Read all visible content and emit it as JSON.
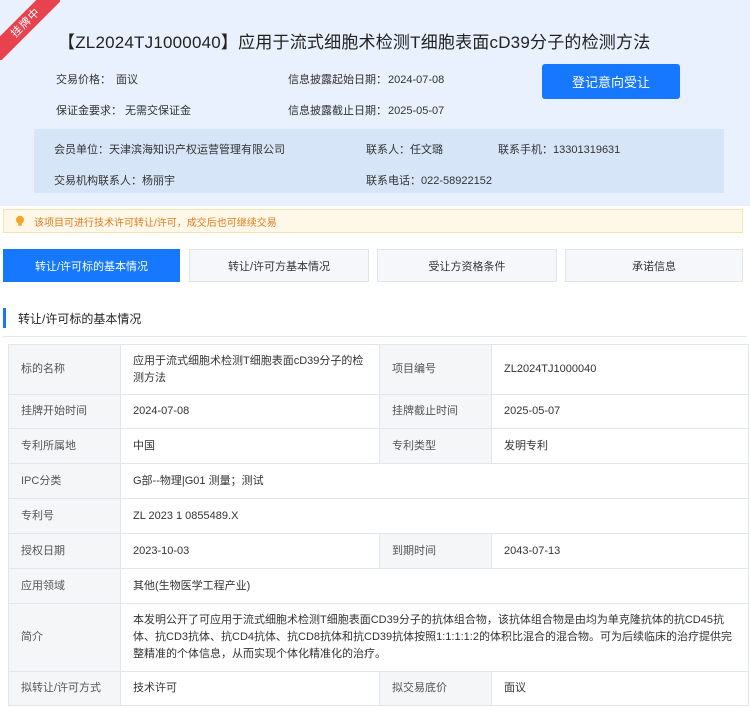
{
  "badge": "挂牌中",
  "title": "【ZL2024TJ1000040】应用于流式细胞术检测T细胞表面cD39分子的检测方法",
  "summary": {
    "price_label": "交易价格：",
    "price_value": "面议",
    "deposit_label": "保证金要求：",
    "deposit_value": "无需交保证金",
    "start_label": "信息披露起始日期：",
    "start_value": "2024-07-08",
    "end_label": "信息披露截止日期：",
    "end_value": "2025-05-07"
  },
  "register_button": "登记意向受让",
  "contact": {
    "member_label": "会员单位：",
    "member_value": "天津滨海知识产权运营管理有限公司",
    "contact_label": "联系人：",
    "contact_value": "任文璐",
    "mobile_label": "联系手机：",
    "mobile_value": "13301319631",
    "agency_label": "交易机构联系人：",
    "agency_value": "杨丽宇",
    "phone_label": "联系电话：",
    "phone_value": "022-58922152"
  },
  "notice": "该项目可进行技术许可转让/许可，成交后也可继续交易",
  "tabs": [
    {
      "label": "转让/许可标的基本情况",
      "active": true
    },
    {
      "label": "转让/许可方基本情况",
      "active": false
    },
    {
      "label": "受让方资格条件",
      "active": false
    },
    {
      "label": "承诺信息",
      "active": false
    }
  ],
  "section_title": "转让/许可标的基本情况",
  "details": {
    "name_k": "标的名称",
    "name_v": "应用于流式细胞术检测T细胞表面cD39分子的检测方法",
    "code_k": "项目编号",
    "code_v": "ZL2024TJ1000040",
    "list_start_k": "挂牌开始时间",
    "list_start_v": "2024-07-08",
    "list_end_k": "挂牌截止时间",
    "list_end_v": "2025-05-07",
    "region_k": "专利所属地",
    "region_v": "中国",
    "type_k": "专利类型",
    "type_v": "发明专利",
    "ipc_k": "IPC分类",
    "ipc_v": "G部--物理|G01 测量；测试",
    "patent_no_k": "专利号",
    "patent_no_v": "ZL 2023 1 0855489.X",
    "grant_k": "授权日期",
    "grant_v": "2023-10-03",
    "expire_k": "到期时间",
    "expire_v": "2043-07-13",
    "field_k": "应用领域",
    "field_v": "其他(生物医学工程产业)",
    "abstract_k": "简介",
    "abstract_v": "本发明公开了可应用于流式细胞术检测T细胞表面CD39分子的抗体组合物，该抗体组合物是由均为单克隆抗体的抗CD45抗体、抗CD3抗体、抗CD4抗体、抗CD8抗体和抗CD39抗体按照1:1:1:1:2的体积比混合的混合物。可为后续临床的治疗提供完整精准的个体信息，从而实现个体化精准化的治疗。",
    "mode_k": "拟转让/许可方式",
    "mode_v": "技术许可",
    "base_price_k": "拟交易底价",
    "base_price_v": "面议"
  },
  "colors": {
    "accent": "#1677ff",
    "header_bg": "#e8f1fd",
    "contact_bg": "#d7e5f8",
    "badge": "#e8424e",
    "notice_text": "#e07b20"
  }
}
